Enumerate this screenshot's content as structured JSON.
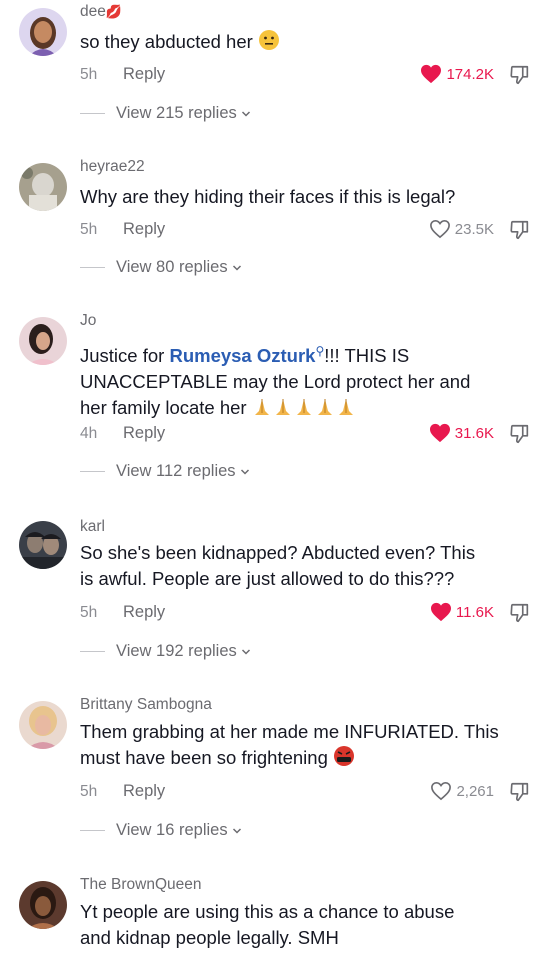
{
  "comments": [
    {
      "username": "dee",
      "text": "so they abducted her",
      "time": "5h",
      "reply": "Reply",
      "likes": "174.2K",
      "liked": true,
      "view_replies": "View 215 replies"
    },
    {
      "username": "heyrae22",
      "text": "Why are they hiding their faces if this is legal?",
      "time": "5h",
      "reply": "Reply",
      "likes": "23.5K",
      "liked": false,
      "view_replies": "View 80 replies"
    },
    {
      "username": "Jo",
      "text_before": "Justice for ",
      "mention": "Rumeysa Ozturk",
      "text_line1_after": "!!! THIS IS",
      "text_line2": "UNACCEPTABLE may the Lord protect her and",
      "text_line3": "her family locate her",
      "time": "4h",
      "reply": "Reply",
      "likes": "31.6K",
      "liked": true,
      "view_replies": "View 112 replies"
    },
    {
      "username": "karl",
      "text_line1": "So she's been kidnapped? Abducted even? This",
      "text_line2": "is awful. People are just allowed to do this???",
      "time": "5h",
      "reply": "Reply",
      "likes": "11.6K",
      "liked": true,
      "view_replies": "View 192 replies"
    },
    {
      "username": "Brittany Sambogna",
      "text_line1": "Them grabbing at her made me INFURIATED. This",
      "text_line2": "must have been so frightening",
      "time": "5h",
      "reply": "Reply",
      "likes": "2,261",
      "liked": false,
      "view_replies": "View 16 replies"
    },
    {
      "username": "The BrownQueen",
      "text_line1": "Yt people are using this as a chance to abuse",
      "text_line2": "and kidnap people legally. SMH"
    }
  ],
  "colors": {
    "like_active": "#e8184e",
    "mention": "#2b5db3",
    "secondary_text": "#8a8b91"
  }
}
